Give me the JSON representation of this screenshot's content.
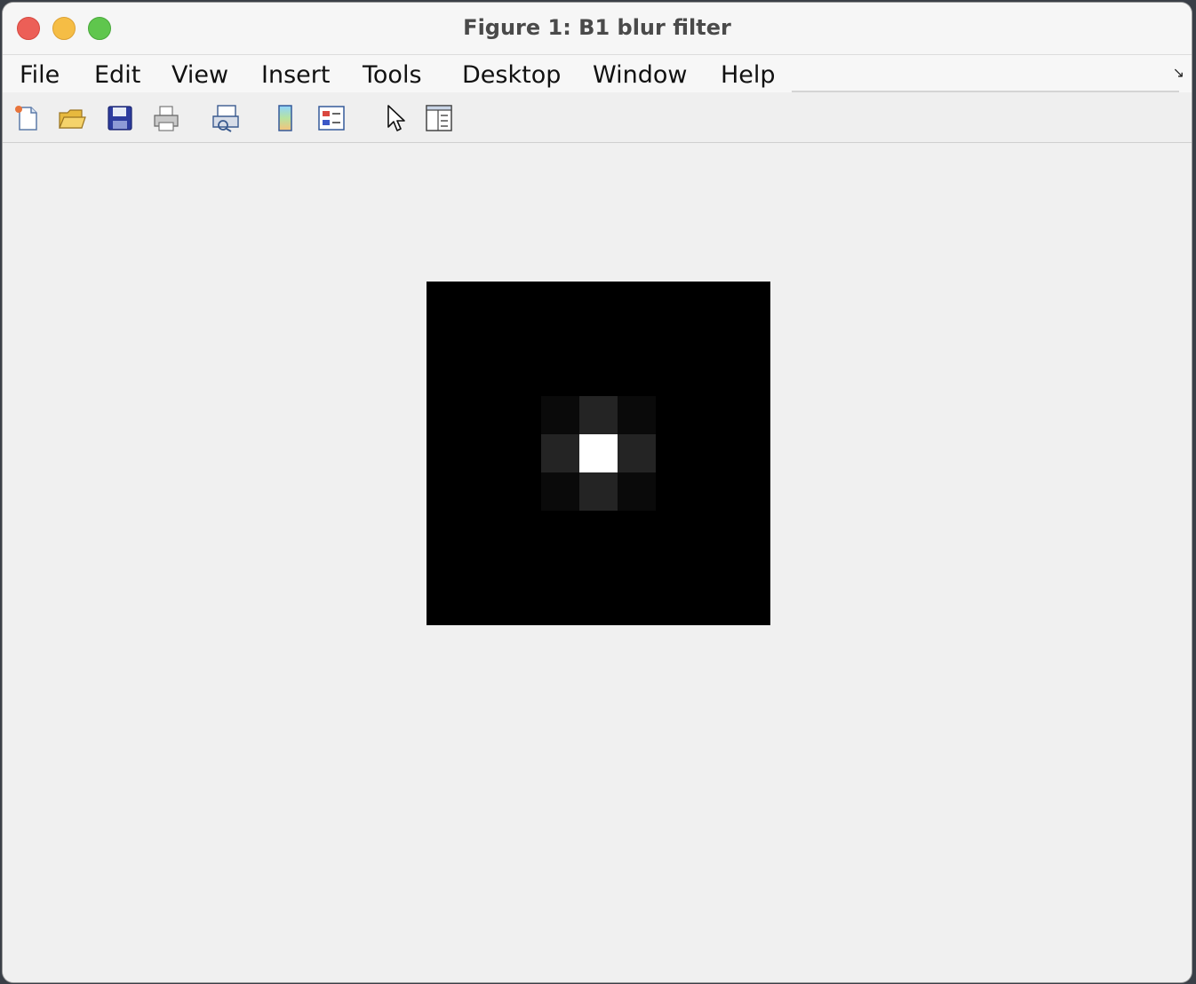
{
  "window": {
    "title": "Figure 1: B1 blur filter"
  },
  "menu": {
    "items": [
      "File",
      "Edit",
      "View",
      "Insert",
      "Tools",
      "Desktop",
      "Window",
      "Help"
    ]
  },
  "toolbar": {
    "icons": [
      "new-figure-icon",
      "open-file-icon",
      "save-icon",
      "print-icon",
      "print-preview-icon",
      "colorbar-icon",
      "legend-icon",
      "edit-plot-pointer-icon",
      "property-inspector-icon"
    ]
  },
  "image": {
    "grid_size": 9,
    "center_intensity": 1.0,
    "edge_neighbor_intensity": 0.14,
    "corner_neighbor_intensity": 0.04,
    "background_intensity": 0.0
  }
}
